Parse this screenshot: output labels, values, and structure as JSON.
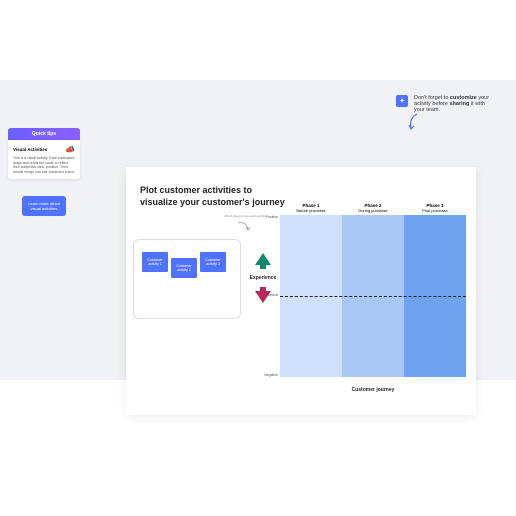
{
  "top_tip": {
    "text_a": "Don't forget to ",
    "bold_a": "customize",
    "text_b": " your activity before ",
    "bold_b": "sharing",
    "text_c": " it with your team."
  },
  "quick_tips": {
    "header": "Quick tips",
    "title": "Visual Activities",
    "body": "This is a visual activity. Each participant drags and drops the cards to reflect their subjective rank, position. Then results merge into one combined board."
  },
  "learn_btn": "Learn more about visual activities",
  "canvas": {
    "title_a": "Plot customer activities to",
    "title_b": "visualize your ",
    "title_hl": "customer's journey",
    "scribble": "click & drag to plot each activity"
  },
  "activities": [
    {
      "label": "Customer activity 1"
    },
    {
      "label": "Customer activity 2"
    },
    {
      "label": "Customer activity 3"
    }
  ],
  "experience_label": "Experience",
  "chart_data": {
    "type": "area",
    "title": "",
    "x_categories": [
      {
        "name": "Phase 1",
        "sub": "Before purchase"
      },
      {
        "name": "Phase 2",
        "sub": "During purchase"
      },
      {
        "name": "Phase 3",
        "sub": "Post purchase"
      }
    ],
    "y_ticks": [
      "Positive",
      "Neutral",
      "Negative"
    ],
    "ylim": [
      "Negative",
      "Positive"
    ],
    "xlabel": "Customer journey",
    "ylabel": "Experience",
    "series": [],
    "phase_colors": [
      "#cfe0fb",
      "#a9c8f7",
      "#6fa3ef"
    ],
    "neutral_line": true
  }
}
